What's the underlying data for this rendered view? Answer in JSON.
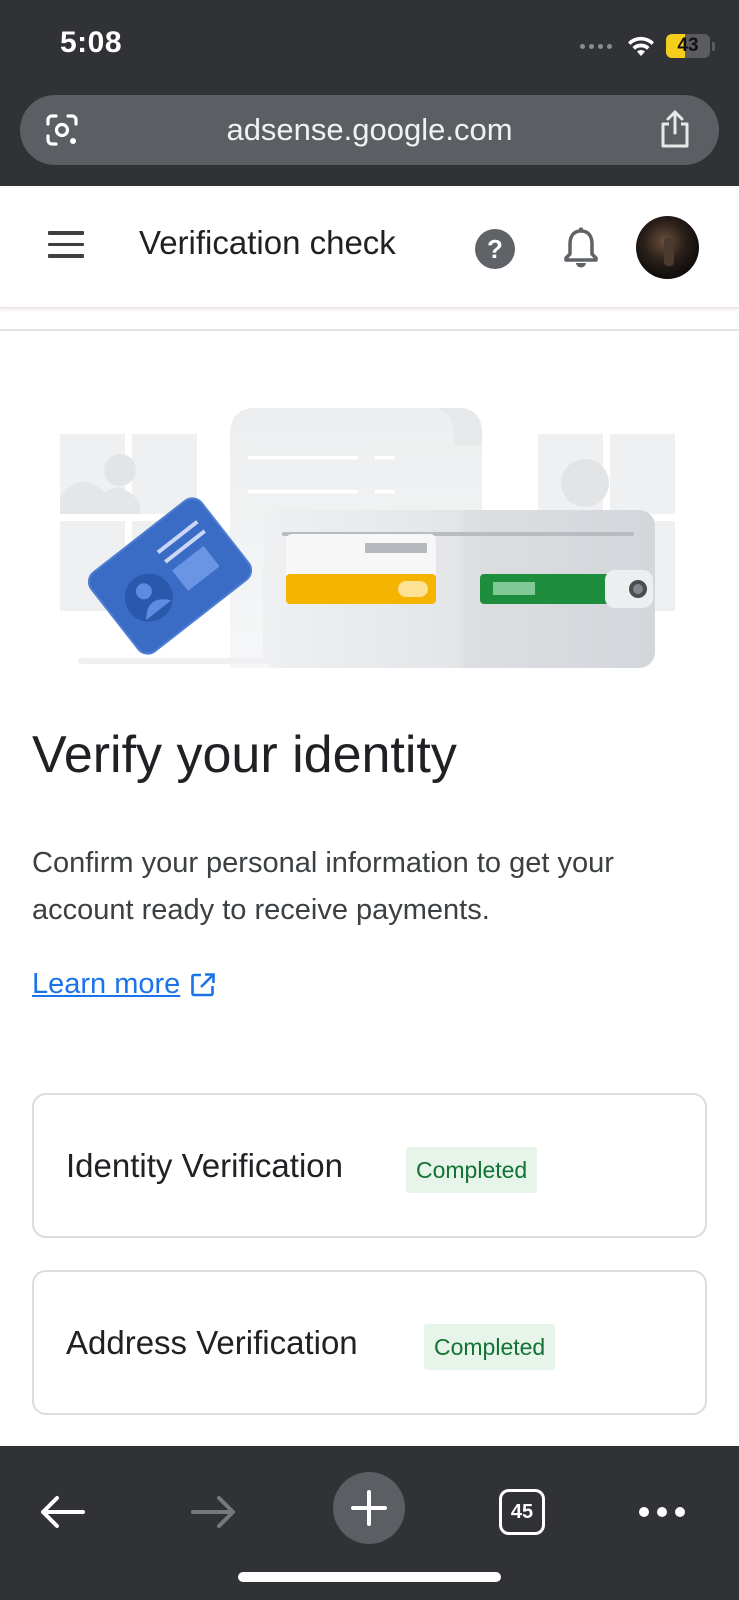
{
  "status_bar": {
    "time": "5:08",
    "battery_level": "43",
    "battery_fraction": 0.43
  },
  "browser": {
    "url": "adsense.google.com",
    "tab_count": "45"
  },
  "header": {
    "title": "Verification check"
  },
  "main": {
    "headline": "Verify your identity",
    "description": "Confirm your personal information to get your account ready to receive payments.",
    "learn_more": "Learn more",
    "cards": [
      {
        "title": "Identity Verification",
        "status": "Completed"
      },
      {
        "title": "Address Verification",
        "status": "Completed"
      }
    ]
  },
  "colors": {
    "chrome_bg": "#303235",
    "link": "#1a73e8",
    "badge_bg": "#e6f4ea",
    "badge_text": "#137333",
    "battery": "#f5cd1d"
  },
  "icons": {
    "url_left": "google-lens-icon",
    "url_right": "share-icon",
    "menu": "hamburger-menu-icon",
    "help": "help-circle-icon",
    "notifications": "bell-icon",
    "external": "external-link-icon",
    "back": "arrow-left-icon",
    "forward": "arrow-right-icon",
    "new_tab": "plus-icon",
    "tabs": "tab-switcher-icon",
    "more": "more-horizontal-icon"
  }
}
